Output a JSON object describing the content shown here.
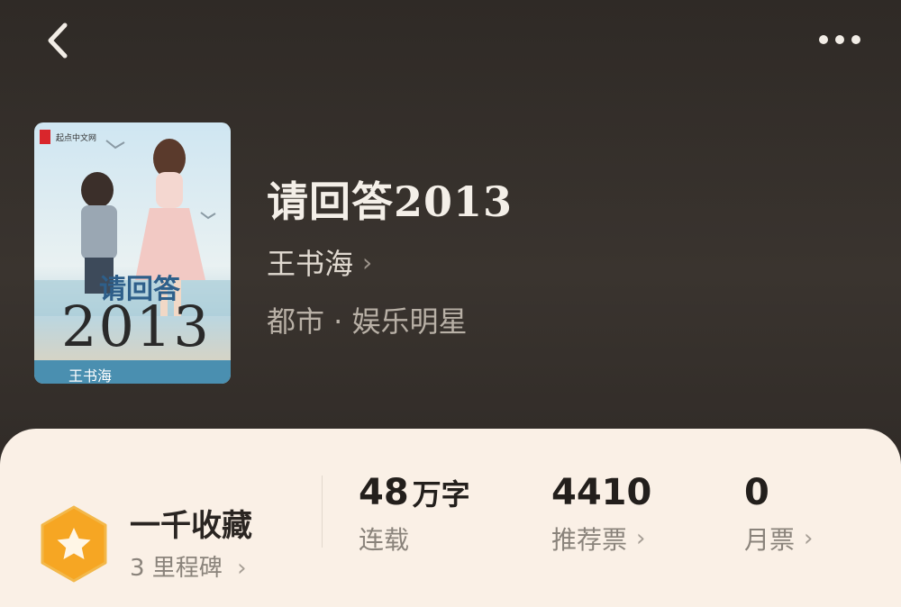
{
  "book": {
    "title": "请回答2013",
    "author": "王书海",
    "genre": "都市 · 娱乐明星",
    "cover": {
      "publisher": "起点中文网",
      "title_line1": "请回答",
      "title_line2": "2013",
      "author": "王书海"
    }
  },
  "milestone": {
    "title": "一千收藏",
    "subtitle": "3 里程碑",
    "icon": "star-hexagon-icon",
    "color": "#f5a623"
  },
  "stats": [
    {
      "value": "48",
      "unit": "万字",
      "label": "连载"
    },
    {
      "value": "4410",
      "label": "推荐票"
    },
    {
      "value": "0",
      "label": "月票"
    }
  ],
  "icons": {
    "back": "chevron-left-icon",
    "more": "more-dots-icon",
    "chevron": "›"
  }
}
